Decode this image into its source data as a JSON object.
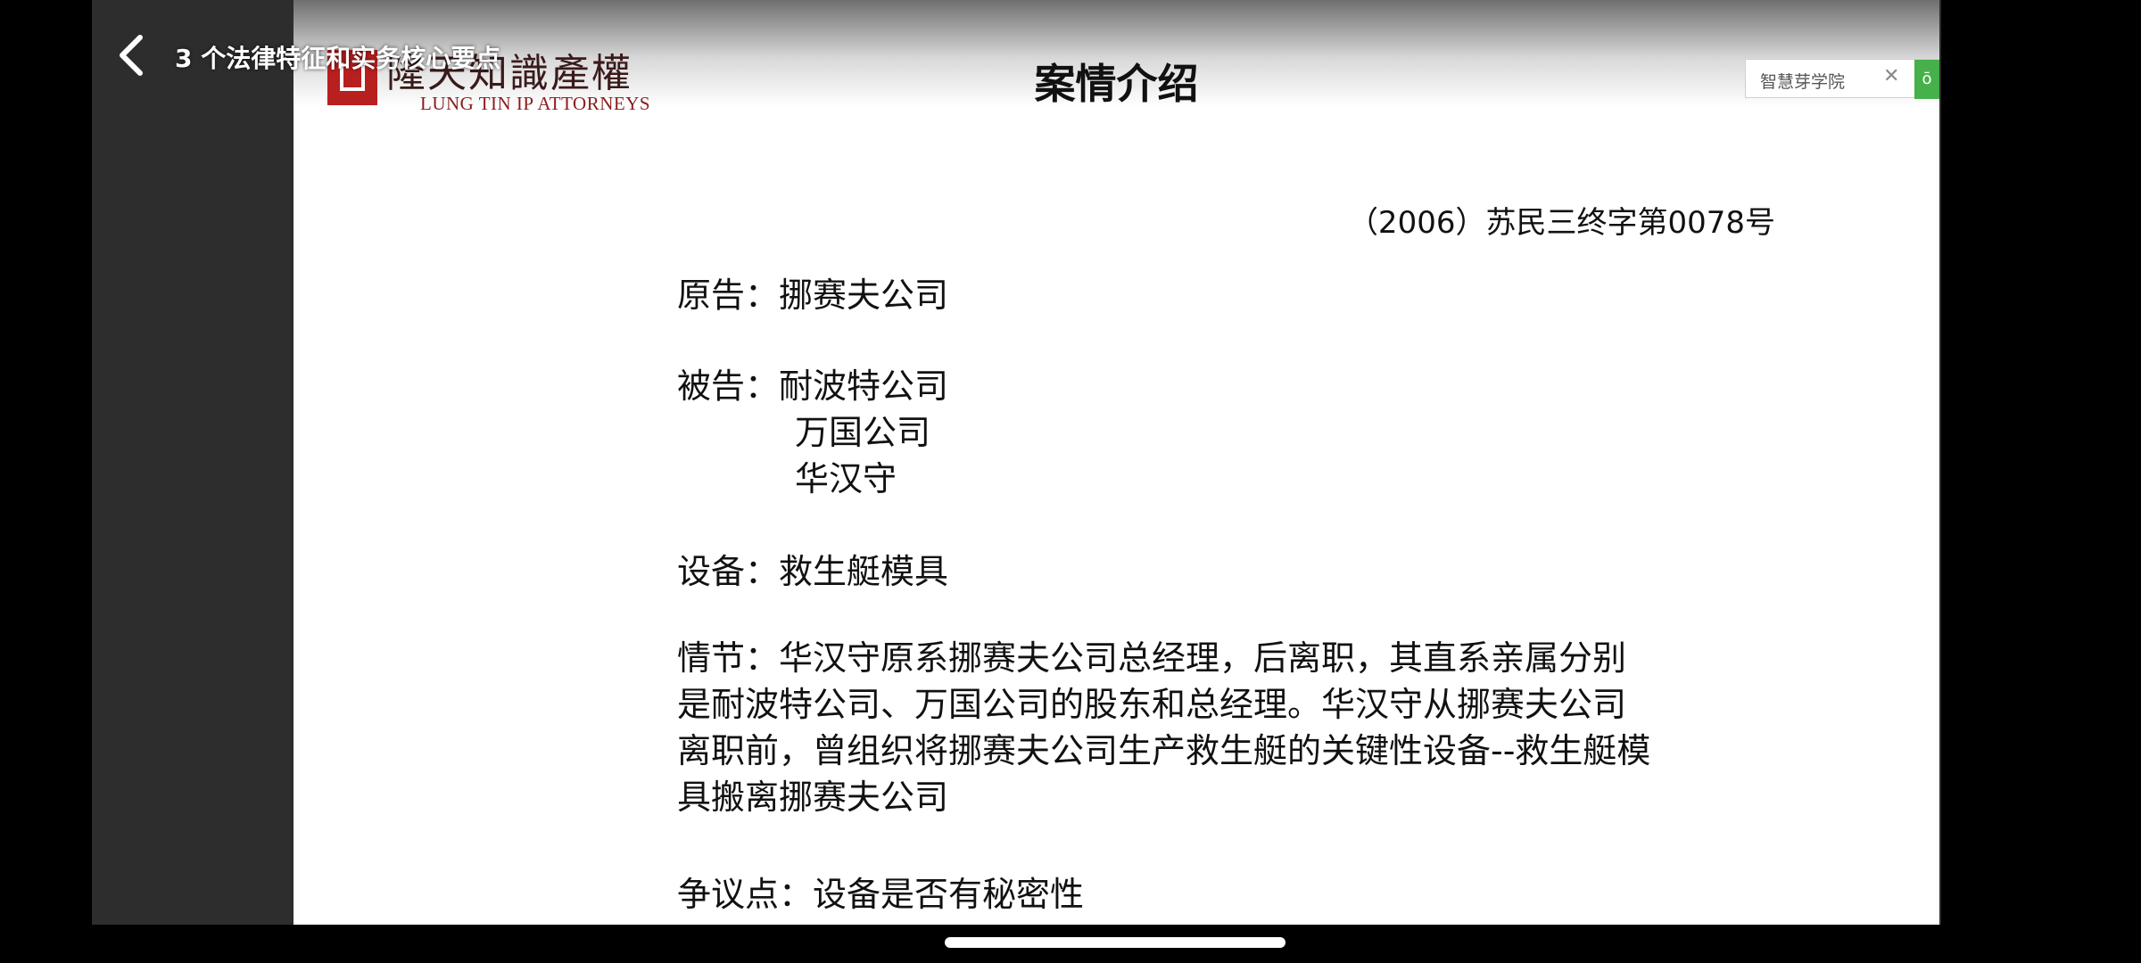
{
  "player": {
    "video_title": "3 个法律特征和实务核心要点",
    "back_icon": "chevron-left-icon"
  },
  "slide": {
    "logo_text_cn": "隆天知識產權",
    "logo_text_en": "LUNG TIN IP ATTORNEYS",
    "title": "案情介绍",
    "side_widget": {
      "label": "智慧芽学院",
      "close_icon": "close-icon",
      "button_label": "ō"
    },
    "case_number": "（2006）苏民三终字第0078号",
    "plaintiff": "原告：挪赛夫公司",
    "defendant_first": "被告：耐波特公司",
    "defendant_others": [
      "万国公司",
      "华汉守"
    ],
    "equipment": "设备：救生艇模具",
    "facts_lines": [
      "情节：华汉守原系挪赛夫公司总经理，后离职，其直系亲属分别",
      "是耐波特公司、万国公司的股东和总经理。华汉守从挪赛夫公司",
      "离职前，曾组织将挪赛夫公司生产救生艇的关键性设备--救生艇模",
      "具搬离挪赛夫公司"
    ],
    "dispute": "争议点：设备是否有秘密性"
  },
  "colors": {
    "logo_red": "#b81f1f",
    "widget_green": "#46b04a",
    "background": "#000000"
  }
}
